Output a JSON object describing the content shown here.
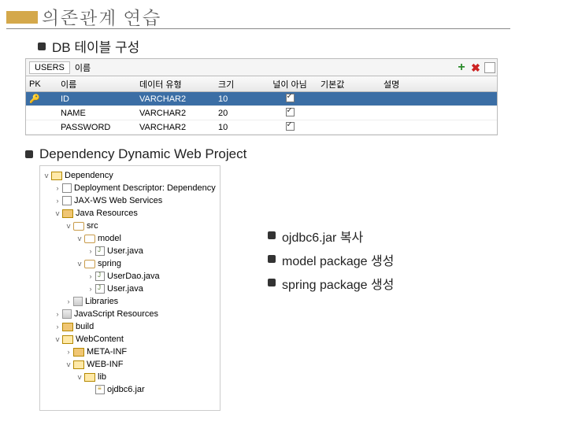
{
  "title": "의존관계 연습",
  "section1_label": "DB 테이블 구성",
  "table": {
    "tab_name": "USERS",
    "tab_hint": "이름",
    "headers": {
      "pk": "PK",
      "name": "이름",
      "type": "데이터 유형",
      "size": "크기",
      "null": "널이 아님",
      "default": "기본값",
      "comment": "설명"
    },
    "rows": [
      {
        "pk": true,
        "name": "ID",
        "type": "VARCHAR2",
        "size": "10",
        "notnull": true
      },
      {
        "pk": false,
        "name": "NAME",
        "type": "VARCHAR2",
        "size": "20",
        "notnull": true
      },
      {
        "pk": false,
        "name": "PASSWORD",
        "type": "VARCHAR2",
        "size": "10",
        "notnull": true
      }
    ]
  },
  "section2_label": "Dependency Dynamic Web Project",
  "tree": {
    "n0": "Dependency",
    "n1": "Deployment Descriptor: Dependency",
    "n2": "JAX-WS Web Services",
    "n3": "Java Resources",
    "n4": "src",
    "n5": "model",
    "n6": "User.java",
    "n7": "spring",
    "n8": "UserDao.java",
    "n9": "User.java",
    "n10": "Libraries",
    "n11": "JavaScript Resources",
    "n12": "build",
    "n13": "WebContent",
    "n14": "META-INF",
    "n15": "WEB-INF",
    "n16": "lib",
    "n17": "ojdbc6.jar"
  },
  "notes": {
    "a": "ojdbc6.jar 복사",
    "b": "model package 생성",
    "c": "spring  package 생성"
  }
}
